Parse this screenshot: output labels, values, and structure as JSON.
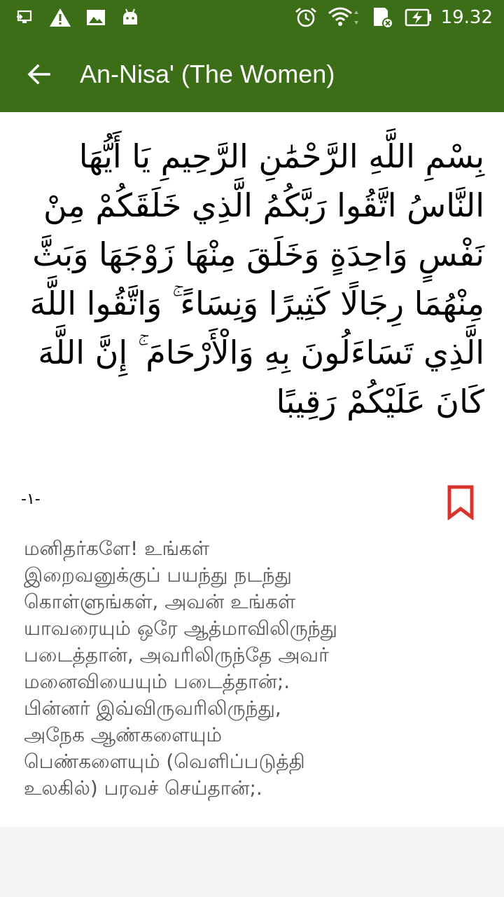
{
  "status_bar": {
    "icons": [
      "screen-cast-icon",
      "warning-icon",
      "image-icon",
      "android-icon",
      "alarm-icon",
      "wifi-icon",
      "sd-card-icon",
      "battery-charging-icon"
    ],
    "time": "19.32"
  },
  "app_bar": {
    "back_icon": "arrow-left-icon",
    "title": "An-Nisa' (The Women)"
  },
  "verse": {
    "arabic": "بِسْمِ اللَّهِ الرَّحْمَٰنِ الرَّحِيمِ يَا أَيُّهَا النَّاسُ اتَّقُوا رَبَّكُمُ الَّذِي خَلَقَكُمْ مِنْ نَفْسٍ وَاحِدَةٍ وَخَلَقَ مِنْهَا زَوْجَهَا وَبَثَّ مِنْهُمَا رِجَالًا كَثِيرًا وَنِسَاءً ۚ وَاتَّقُوا اللَّهَ الَّذِي تَسَاءَلُونَ بِهِ وَالْأَرْحَامَ ۚ إِنَّ اللَّهَ كَانَ عَلَيْكُمْ رَقِيبًا",
    "number": "-١-",
    "bookmark_icon": "bookmark-icon",
    "translation": "மனிதர்களே! உங்கள்\nஇறைவனுக்குப் பயந்து நடந்து\nகொள்ளுங்கள், அவன் உங்கள்\nயாவரையும் ஒரே ஆத்மாவிலிருந்து\nபடைத்தான், அவரிலிருந்தே அவர்\nமனைவியையும் படைத்தான்;.\nபின்னர் இவ்விருவரிலிருந்து,\nஅநேக ஆண்களையும்\nபெண்களையும் (வெளிப்படுத்தி\nஉலகில்) பரவச் செய்தான்;."
  },
  "colors": {
    "app_bar": "#3b6e17",
    "bookmark": "#d9342b",
    "translation_text": "#555555"
  }
}
